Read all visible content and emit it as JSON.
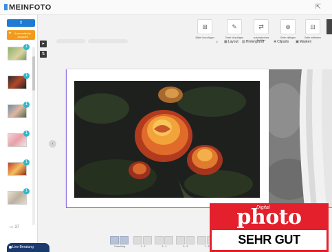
{
  "app": {
    "logo_text": "MEINFOTO"
  },
  "sidebar": {
    "upload_label": "⇪",
    "orange_label": "Automatische Auswahl",
    "thumbs": [
      {
        "badge": "1"
      },
      {
        "badge": "1"
      },
      {
        "badge": "1"
      },
      {
        "badge": "1"
      },
      {
        "badge": "1"
      },
      {
        "badge": "1"
      }
    ],
    "footer": "▭ 37"
  },
  "toolbar": {
    "buttons": [
      {
        "icon": "text-add-icon",
        "label": "Bilder hinzufügen"
      },
      {
        "icon": "text-add-icon",
        "label": "Texte hinzufügen"
      },
      {
        "icon": "auto-fill-icon",
        "label": "automatisches Befüllen"
      },
      {
        "icon": "page-add-icon",
        "label": "Seite einfügen"
      },
      {
        "icon": "page-remove-icon",
        "label": "Seite entfernen"
      }
    ],
    "row2": {
      "home": "⌂",
      "layout": "Layout",
      "background": "Hintergrund",
      "cliparts": "Cliparts",
      "masks": "Masken"
    }
  },
  "bottom_pages": [
    {
      "label": "Umschlag"
    },
    {
      "label": "1 - 2"
    },
    {
      "label": "3 - 4"
    },
    {
      "label": "5 - 6"
    },
    {
      "label": "7 - 8"
    }
  ],
  "live_help": "Live Beratung",
  "award": {
    "digital": "Digital",
    "photo": "photo",
    "verdict": "SEHR GUT"
  },
  "colors": {
    "accent_blue": "#1e7ad3",
    "accent_orange": "#f39a1b",
    "badge_red": "#e3202b",
    "spread_purple": "#8c6fe0"
  }
}
